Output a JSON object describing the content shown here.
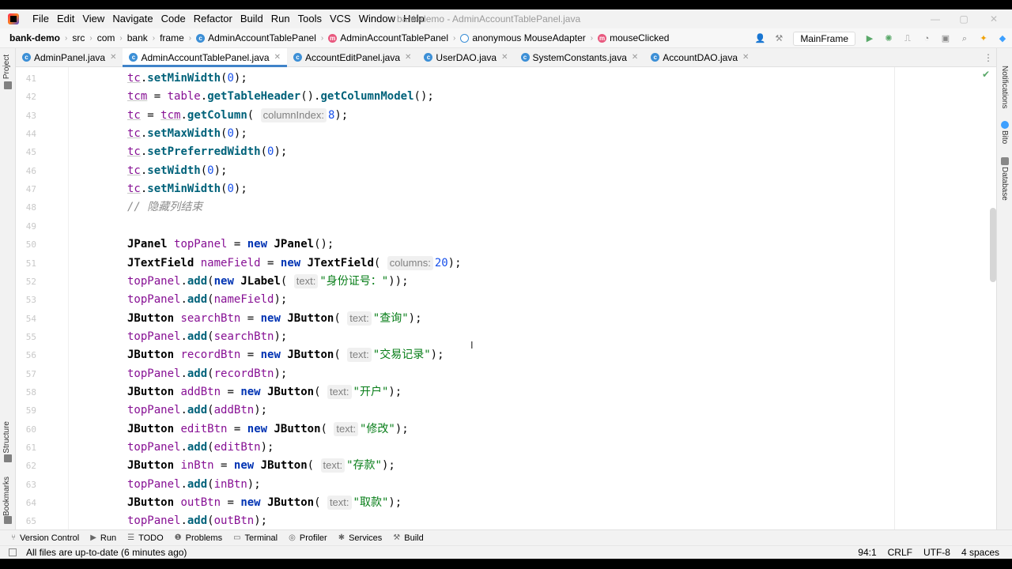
{
  "window": {
    "title": "bank-demo - AdminAccountTablePanel.java"
  },
  "menu": [
    "File",
    "Edit",
    "View",
    "Navigate",
    "Code",
    "Refactor",
    "Build",
    "Run",
    "Tools",
    "VCS",
    "Window",
    "Help"
  ],
  "breadcrumbs": [
    {
      "label": "bank-demo",
      "icon": ""
    },
    {
      "label": "src",
      "icon": ""
    },
    {
      "label": "com",
      "icon": ""
    },
    {
      "label": "bank",
      "icon": ""
    },
    {
      "label": "frame",
      "icon": ""
    },
    {
      "label": "AdminAccountTablePanel",
      "icon": "class-icon"
    },
    {
      "label": "AdminAccountTablePanel",
      "icon": "method-icon"
    },
    {
      "label": "anonymous MouseAdapter",
      "icon": "anonymous-class-icon"
    },
    {
      "label": "mouseClicked",
      "icon": "method-icon"
    }
  ],
  "run_config": "MainFrame",
  "tabs": [
    {
      "label": "AdminPanel.java",
      "active": false
    },
    {
      "label": "AdminAccountTablePanel.java",
      "active": true
    },
    {
      "label": "AccountEditPanel.java",
      "active": false
    },
    {
      "label": "UserDAO.java",
      "active": false
    },
    {
      "label": "SystemConstants.java",
      "active": false
    },
    {
      "label": "AccountDAO.java",
      "active": false
    }
  ],
  "left_tools": [
    "Project",
    "Structure",
    "Bookmarks"
  ],
  "right_tools": [
    "Notifications",
    "Bito",
    "Database"
  ],
  "code_lines": [
    {
      "n": "41",
      "html": "<span class=\"fld und\">tc</span>.<span class=\"mth\">setMinWidth</span>(<span class=\"num\">0</span>);"
    },
    {
      "n": "42",
      "html": "<span class=\"fld und\">tcm</span> = <span class=\"fld\">table</span>.<span class=\"mth\">getTableHeader</span>().<span class=\"mth\">getColumnModel</span>();"
    },
    {
      "n": "43",
      "html": "<span class=\"fld und\">tc</span> = <span class=\"fld und\">tcm</span>.<span class=\"mth\">getColumn</span>( <span class=\"hint\">columnIndex:</span><span class=\"num\">8</span>);"
    },
    {
      "n": "44",
      "html": "<span class=\"fld und\">tc</span>.<span class=\"mth\">setMaxWidth</span>(<span class=\"num\">0</span>);"
    },
    {
      "n": "45",
      "html": "<span class=\"fld und\">tc</span>.<span class=\"mth\">setPreferredWidth</span>(<span class=\"num\">0</span>);"
    },
    {
      "n": "46",
      "html": "<span class=\"fld und\">tc</span>.<span class=\"mth\">setWidth</span>(<span class=\"num\">0</span>);"
    },
    {
      "n": "47",
      "html": "<span class=\"fld und\">tc</span>.<span class=\"mth\">setMinWidth</span>(<span class=\"num\">0</span>);"
    },
    {
      "n": "48",
      "html": "<span class=\"cmt\">// 隐藏列结束</span>"
    },
    {
      "n": "49",
      "html": ""
    },
    {
      "n": "50",
      "html": "<span class=\"cls\">JPanel</span> <span class=\"fld\">topPanel</span> = <span class=\"kw\">new</span> <span class=\"cls\">JPanel</span>();"
    },
    {
      "n": "51",
      "html": "<span class=\"cls\">JTextField</span> <span class=\"fld\">nameField</span> = <span class=\"kw\">new</span> <span class=\"cls\">JTextField</span>( <span class=\"hint\">columns:</span><span class=\"num\">20</span>);"
    },
    {
      "n": "52",
      "html": "<span class=\"fld\">topPanel</span>.<span class=\"mth\">add</span>(<span class=\"kw\">new</span> <span class=\"cls\">JLabel</span>( <span class=\"hint\">text:</span><span class=\"str\">\"身份证号：\"</span>));"
    },
    {
      "n": "53",
      "html": "<span class=\"fld\">topPanel</span>.<span class=\"mth\">add</span>(<span class=\"fld\">nameField</span>);"
    },
    {
      "n": "54",
      "html": "<span class=\"cls\">JButton</span> <span class=\"fld\">searchBtn</span> = <span class=\"kw\">new</span> <span class=\"cls\">JButton</span>( <span class=\"hint\">text:</span><span class=\"str\">\"查询\"</span>);"
    },
    {
      "n": "55",
      "html": "<span class=\"fld\">topPanel</span>.<span class=\"mth\">add</span>(<span class=\"fld\">searchBtn</span>);"
    },
    {
      "n": "56",
      "html": "<span class=\"cls\">JButton</span> <span class=\"fld\">recordBtn</span> = <span class=\"kw\">new</span> <span class=\"cls\">JButton</span>( <span class=\"hint\">text:</span><span class=\"str\">\"交易记录\"</span>);"
    },
    {
      "n": "57",
      "html": "<span class=\"fld\">topPanel</span>.<span class=\"mth\">add</span>(<span class=\"fld\">recordBtn</span>);"
    },
    {
      "n": "58",
      "html": "<span class=\"cls\">JButton</span> <span class=\"fld\">addBtn</span> = <span class=\"kw\">new</span> <span class=\"cls\">JButton</span>( <span class=\"hint\">text:</span><span class=\"str\">\"开户\"</span>);"
    },
    {
      "n": "59",
      "html": "<span class=\"fld\">topPanel</span>.<span class=\"mth\">add</span>(<span class=\"fld\">addBtn</span>);"
    },
    {
      "n": "60",
      "html": "<span class=\"cls\">JButton</span> <span class=\"fld\">editBtn</span> = <span class=\"kw\">new</span> <span class=\"cls\">JButton</span>( <span class=\"hint\">text:</span><span class=\"str\">\"修改\"</span>);"
    },
    {
      "n": "61",
      "html": "<span class=\"fld\">topPanel</span>.<span class=\"mth\">add</span>(<span class=\"fld\">editBtn</span>);"
    },
    {
      "n": "62",
      "html": "<span class=\"cls\">JButton</span> <span class=\"fld\">inBtn</span> = <span class=\"kw\">new</span> <span class=\"cls\">JButton</span>( <span class=\"hint\">text:</span><span class=\"str\">\"存款\"</span>);"
    },
    {
      "n": "63",
      "html": "<span class=\"fld\">topPanel</span>.<span class=\"mth\">add</span>(<span class=\"fld\">inBtn</span>);"
    },
    {
      "n": "64",
      "html": "<span class=\"cls\">JButton</span> <span class=\"fld\">outBtn</span> = <span class=\"kw\">new</span> <span class=\"cls\">JButton</span>( <span class=\"hint\">text:</span><span class=\"str\">\"取款\"</span>);"
    },
    {
      "n": "65",
      "html": "<span class=\"fld\">topPanel</span>.<span class=\"mth\">add</span>(<span class=\"fld\">outBtn</span>);"
    }
  ],
  "bottom_tools": [
    {
      "label": "Version Control",
      "icon": "branch-icon"
    },
    {
      "label": "Run",
      "icon": "play-icon"
    },
    {
      "label": "TODO",
      "icon": "list-icon"
    },
    {
      "label": "Problems",
      "icon": "warning-icon"
    },
    {
      "label": "Terminal",
      "icon": "terminal-icon"
    },
    {
      "label": "Profiler",
      "icon": "profiler-icon"
    },
    {
      "label": "Services",
      "icon": "services-icon"
    },
    {
      "label": "Build",
      "icon": "hammer-icon"
    }
  ],
  "status": {
    "message": "All files are up-to-date (6 minutes ago)",
    "position": "94:1",
    "line_separator": "CRLF",
    "encoding": "UTF-8",
    "indent": "4 spaces"
  },
  "colors": {
    "keyword": "#0033b3",
    "field": "#871094",
    "method": "#00627a",
    "number": "#1750eb",
    "string": "#067d17",
    "comment": "#8c8c8c",
    "accent": "#4083c9"
  }
}
